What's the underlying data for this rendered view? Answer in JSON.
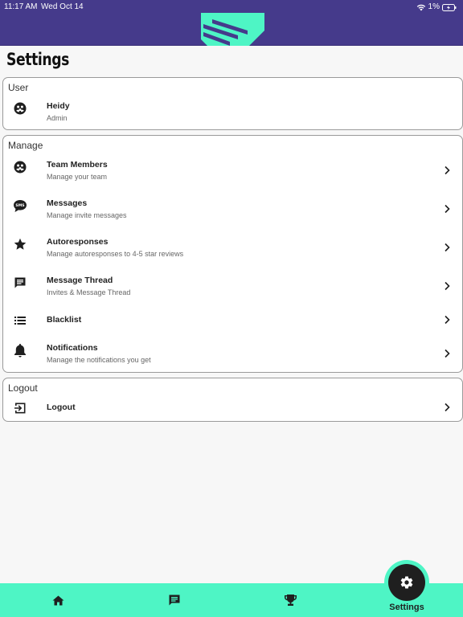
{
  "status_bar": {
    "time": "11:17 AM",
    "date": "Wed Oct 14",
    "battery": "1%"
  },
  "colors": {
    "header": "#453a8b",
    "accent": "#4ef5c5",
    "icon": "#1f1f1f"
  },
  "page": {
    "title": "Settings"
  },
  "user_section": {
    "header": "User",
    "name": "Heidy",
    "role": "Admin",
    "icon": "group-icon"
  },
  "manage_section": {
    "header": "Manage",
    "items": [
      {
        "title": "Team Members",
        "subtitle": "Manage your team",
        "icon": "group-icon"
      },
      {
        "title": "Messages",
        "subtitle": "Manage invite messages",
        "icon": "sms-icon"
      },
      {
        "title": "Autoresponses",
        "subtitle": "Manage autoresponses to 4-5 star reviews",
        "icon": "star-icon"
      },
      {
        "title": "Message Thread",
        "subtitle": "Invites & Message Thread",
        "icon": "message-icon"
      },
      {
        "title": "Blacklist",
        "subtitle": "",
        "icon": "list-icon"
      },
      {
        "title": "Notifications",
        "subtitle": "Manage the notifications you get",
        "icon": "bell-icon"
      }
    ]
  },
  "logout_section": {
    "header": "Logout",
    "label": "Logout",
    "icon": "logout-icon"
  },
  "bottom_nav": {
    "items": [
      {
        "icon": "home-icon"
      },
      {
        "icon": "chat-icon"
      },
      {
        "icon": "trophy-icon"
      },
      {
        "icon": "gear-icon",
        "label": "Settings",
        "active": true
      }
    ]
  }
}
